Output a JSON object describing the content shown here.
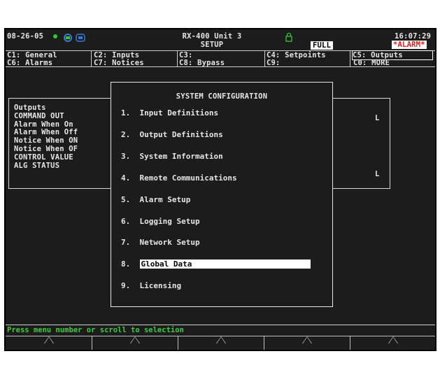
{
  "header": {
    "date": "08-26-05",
    "unit": "RX-400 Unit 3",
    "mode": "SETUP",
    "signal_label": "FULL",
    "time": "16:07:29",
    "alarm": "*ALARM*"
  },
  "tabs": [
    {
      "label": "C1: General"
    },
    {
      "label": "C2: Inputs"
    },
    {
      "label": "C3:"
    },
    {
      "label": "C4: Setpoints"
    },
    {
      "label": "C5: Outputs"
    },
    {
      "label": "C6: Alarms"
    },
    {
      "label": "C7: Notices"
    },
    {
      "label": "C8: Bypass"
    },
    {
      "label": "C9:"
    },
    {
      "label": "C0: MORE"
    }
  ],
  "outputs_panel": {
    "title": "Outputs",
    "rows": [
      "COMMAND OUT",
      "Alarm When On",
      "Alarm When Off",
      "Notice When ON",
      "Notice When OF",
      "CONTROL VALUE",
      "ALG STATUS"
    ],
    "values": [
      "L",
      "L"
    ]
  },
  "menu": {
    "title": "SYSTEM CONFIGURATION",
    "items": [
      {
        "num": "1.",
        "label": "Input Definitions"
      },
      {
        "num": "2.",
        "label": "Output Definitions"
      },
      {
        "num": "3.",
        "label": "System Information"
      },
      {
        "num": "4.",
        "label": "Remote Communications"
      },
      {
        "num": "5.",
        "label": "Alarm Setup"
      },
      {
        "num": "6.",
        "label": "Logging Setup"
      },
      {
        "num": "7.",
        "label": "Network Setup"
      },
      {
        "num": "8.",
        "label": "Global Data"
      },
      {
        "num": "9.",
        "label": "Licensing"
      }
    ],
    "selected_index": 7
  },
  "status_bar": {
    "text": "Press menu number or scroll to selection"
  },
  "icons": [
    "status-dot-icon",
    "phone-icon",
    "battery-icon",
    "lock-icon"
  ],
  "colors": {
    "screen_bg": "#1c1c1c",
    "text": "#e6e6e6",
    "status_green": "#3ccf3c",
    "alarm_red": "#e02020",
    "icon_green": "#32c832",
    "icon_blue": "#3a78d8"
  }
}
